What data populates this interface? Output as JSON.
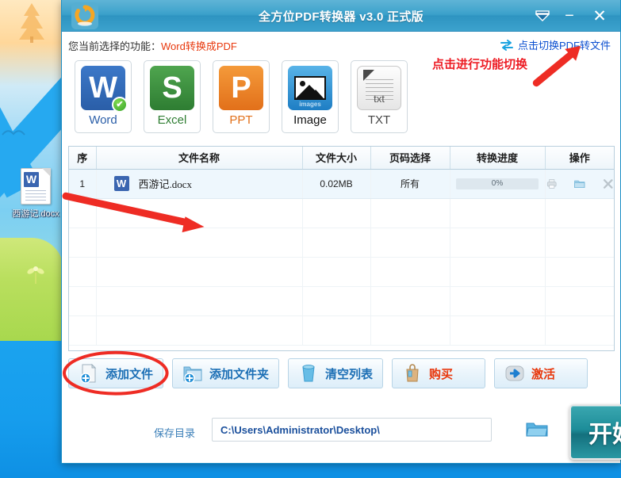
{
  "desktop": {
    "file_icon": {
      "label": "西游记.docx",
      "icon": "word-document-icon"
    }
  },
  "window": {
    "title": "全方位PDF转换器 v3.0 正式版",
    "logo_icon": "refresh-circle-logo",
    "controls": {
      "collapse": "▼",
      "minimize": "−",
      "close": "✕"
    }
  },
  "header": {
    "function_label": "您当前选择的功能：",
    "function_value": "Word转换成PDF",
    "switch_link": "点击切换PDF转文件",
    "switch_icon": "swap-arrows-icon"
  },
  "annotations": {
    "switch_hint": "点击进行功能切换",
    "color": "#ed1c24"
  },
  "formats": [
    {
      "name": "word",
      "letter": "W",
      "label": "Word",
      "selected": true,
      "check": "✔"
    },
    {
      "name": "excel",
      "letter": "S",
      "label": "Excel",
      "selected": false
    },
    {
      "name": "ppt",
      "letter": "P",
      "label": "PPT",
      "selected": false
    },
    {
      "name": "image",
      "letter": "",
      "label": "Image",
      "selected": false,
      "tile_caption": "images"
    },
    {
      "name": "txt",
      "letter": "",
      "label": "TXT",
      "selected": false,
      "tile_caption": "txt"
    }
  ],
  "table": {
    "columns": [
      "序",
      "文件名称",
      "文件大小",
      "页码选择",
      "转换进度",
      "操作"
    ],
    "rows": [
      {
        "index": "1",
        "icon": "word-file-icon",
        "filename": "西游记.docx",
        "size": "0.02MB",
        "pages": "所有",
        "progress": "0%",
        "progress_value": 0,
        "ops": [
          "print-icon",
          "folder-icon",
          "remove-icon"
        ]
      }
    ],
    "empty_rows": 5
  },
  "actions": [
    {
      "name": "add-file",
      "label": "添加文件",
      "icon": "file-plus-icon",
      "style": "blue",
      "highlighted": true
    },
    {
      "name": "add-folder",
      "label": "添加文件夹",
      "icon": "folder-plus-icon",
      "style": "blue",
      "highlighted": false
    },
    {
      "name": "clear-list",
      "label": "清空列表",
      "icon": "trash-icon",
      "style": "blue",
      "highlighted": false
    },
    {
      "name": "buy",
      "label": "购买",
      "icon": "shopping-bag-icon",
      "style": "red",
      "highlighted": false
    },
    {
      "name": "activate",
      "label": "激活",
      "icon": "arrow-badge-icon",
      "style": "red",
      "highlighted": false
    }
  ],
  "footer": {
    "save_label": "保存目录",
    "save_path": "C:\\Users\\Administrator\\Desktop\\",
    "browse_icon": "folder-open-icon",
    "start_label": "开始"
  },
  "colors": {
    "titlebar": "#3ba1cb",
    "accent_red": "#e8380d",
    "link_blue": "#0b4fd0",
    "start_teal": "#1d8d99"
  }
}
